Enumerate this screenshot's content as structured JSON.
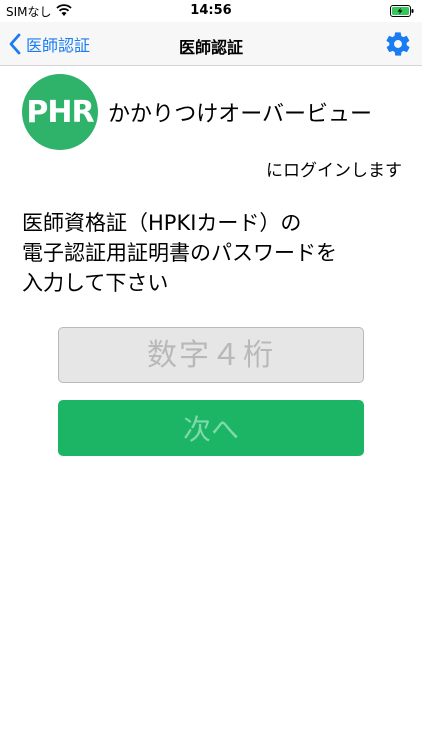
{
  "status_bar": {
    "carrier": "SIMなし",
    "time": "14:56"
  },
  "nav": {
    "back_label": "医師認証",
    "title": "医師認証"
  },
  "logo_text": "PHR",
  "app_name": "かかりつけオーバービュー",
  "login_text": "にログインします",
  "instruction": {
    "line1": "医師資格証（HPKIカード）の",
    "line2": "電子認証用証明書のパスワードを",
    "line3": "入力して下さい"
  },
  "pin_input": {
    "placeholder": "数字４桁",
    "value": ""
  },
  "next_button": {
    "label": "次へ"
  },
  "colors": {
    "accent": "#1a7cf2",
    "brand_green": "#2fb36a",
    "button_green": "#1bb565"
  }
}
